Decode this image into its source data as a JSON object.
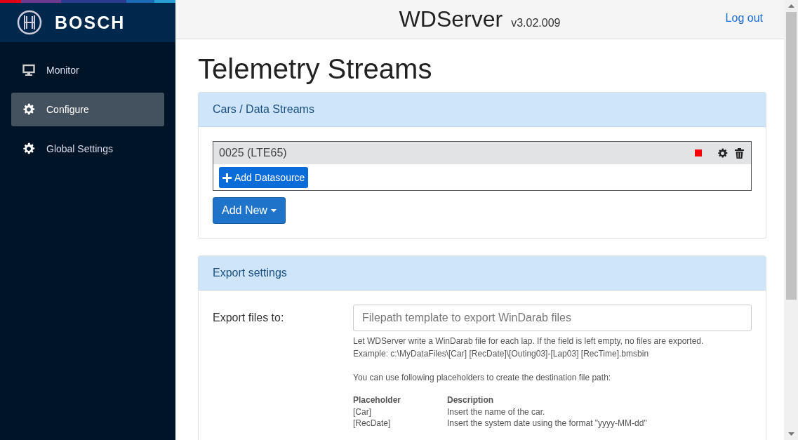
{
  "brand": {
    "name": "BOSCH"
  },
  "header": {
    "app_name": "WDServer",
    "version": "v3.02.009",
    "logout": "Log out"
  },
  "sidebar": {
    "items": [
      {
        "label": "Monitor",
        "kind": "monitor",
        "selected": false
      },
      {
        "label": "Configure",
        "kind": "settings",
        "selected": true
      },
      {
        "label": "Global Settings",
        "kind": "settings",
        "selected": false
      }
    ]
  },
  "page_title": "Telemetry Streams",
  "streams_card": {
    "title": "Cars / Data Streams",
    "cars": [
      {
        "name": "0025 (LTE65)",
        "add_button": "Add Datasource"
      }
    ],
    "add_new": "Add New"
  },
  "export_card": {
    "title": "Export settings",
    "field_label": "Export files to:",
    "placeholder": "Filepath template to export WinDarab files",
    "help": [
      "Let WDServer write a WinDarab file for each lap. If the field is left empty, no files are exported.",
      "Example: c:\\MyDataFiles\\[Car] [RecDate]\\[Outing03]-[Lap03] [RecTime].bmsbin"
    ],
    "intro": "You can use following placeholders to create the destination file path:",
    "table": {
      "columns": [
        "Placeholder",
        "Description"
      ],
      "rows": [
        [
          "[Car]",
          "Insert the name of the car."
        ],
        [
          "[RecDate]",
          "Insert the system date using the format \"yyyy-MM-dd\""
        ]
      ]
    }
  }
}
